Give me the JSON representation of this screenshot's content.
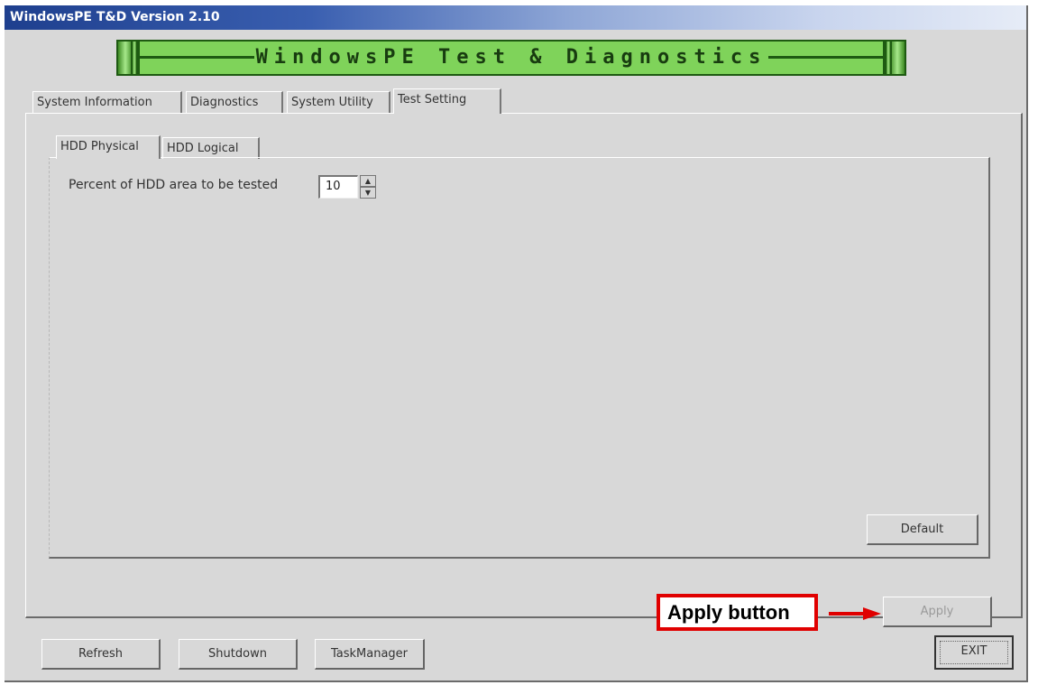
{
  "window": {
    "title": "WindowsPE T&D Version 2.10"
  },
  "banner": {
    "text": "WindowsPE Test & Diagnostics"
  },
  "tabs": [
    {
      "label": "System Information",
      "active": false
    },
    {
      "label": "Diagnostics",
      "active": false
    },
    {
      "label": "System Utility",
      "active": false
    },
    {
      "label": "Test Setting",
      "active": true
    }
  ],
  "subtabs": [
    {
      "label": "HDD Physical",
      "active": true
    },
    {
      "label": "HDD Logical",
      "active": false
    }
  ],
  "settings": {
    "percent_label": "Percent of HDD area to be tested",
    "percent_value": "10"
  },
  "buttons": {
    "default": "Default",
    "apply": "Apply",
    "refresh": "Refresh",
    "shutdown": "Shutdown",
    "taskmanager": "TaskManager",
    "exit": "EXIT"
  },
  "annotation": {
    "text": "Apply button",
    "color": "#e00000"
  }
}
